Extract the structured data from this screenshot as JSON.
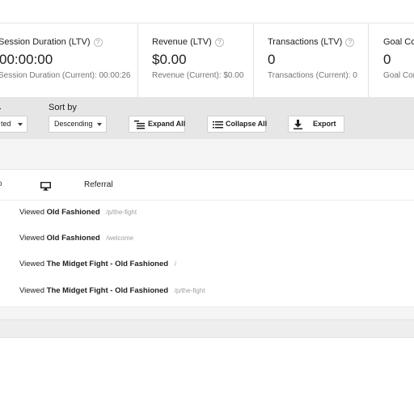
{
  "metrics": [
    {
      "label": "Session Duration (LTV)",
      "value": "00:00:00",
      "sub": "Session Duration (Current): 00:00:26"
    },
    {
      "label": "Revenue (LTV)",
      "value": "$0.00",
      "sub": "Revenue (Current): $0.00"
    },
    {
      "label": "Transactions (LTV)",
      "value": "0",
      "sub": "Transactions (Current): 0"
    },
    {
      "label": "Goal Co",
      "value": "0",
      "sub": "Goal Con"
    }
  ],
  "help_glyph": "?",
  "toolbar": {
    "filter_label_clipped": "",
    "filter_select_value": "ted",
    "sort_label": "Sort by",
    "sort_select_value": "Descending",
    "expand_all": "Expand All",
    "collapse_all": "Collapse All",
    "export": "Export"
  },
  "session": {
    "clipped_text": "o",
    "device_icon": "desktop-icon",
    "channel": "Referral"
  },
  "hits": [
    {
      "verb": "Viewed",
      "title": "Old Fashioned",
      "path": "/p/the-fight"
    },
    {
      "verb": "Viewed",
      "title": "Old Fashioned",
      "path": "/welcome"
    },
    {
      "verb": "Viewed",
      "title": "The Midget Fight - Old Fashioned",
      "path": "/"
    },
    {
      "verb": "Viewed",
      "title": "The Midget Fight - Old Fashioned",
      "path": "/p/the-fight"
    }
  ],
  "colors": {
    "toolbar_bg": "#e6e6e6",
    "band_bg": "#f5f5f5",
    "muted_text": "#757575",
    "path_text": "#9e9e9e"
  }
}
